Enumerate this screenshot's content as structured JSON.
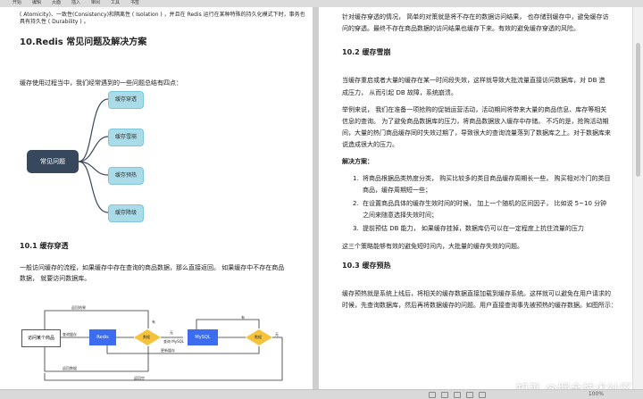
{
  "toolbar": {
    "items": [
      "开始",
      "编辑",
      "页面",
      "插入",
      "审阅",
      "工具",
      "书签"
    ]
  },
  "left": {
    "top_line1": "( Atomicity)、一致性(Consistency)和隔离性 ( Isolation ) ，并且在 Redis 运行在某种特殊的持久化模式下时，事务也",
    "top_line2": "具有持久性 ( Durability ) 。",
    "heading": "10.Redis 常见问题及解决方案",
    "intro": "缓存使用过程当中，我们经常遇到的一些问题总结有四点：",
    "mind": {
      "root": "常见问题",
      "nodes": [
        "缓存穿透",
        "缓存雪崩",
        "缓存预热",
        "缓存降级"
      ]
    },
    "sub_heading": "10.1 缓存穿透",
    "para1": "一般访问缓存的流程，如果缓存中存在查询的商品数据，那么直接返回。 如果缓存中不存在商品",
    "para2": "数据， 就要访问数据库。",
    "flow": {
      "user": "访问某个商品",
      "redis": "Redis",
      "mysql": "MySQL",
      "judge": "数据",
      "judge2": "数据",
      "query_cache": "查询缓存",
      "return_result": "返回结果",
      "none": "无",
      "query_mysql": "查询 MySQL",
      "have": "有",
      "have2": "有",
      "no2": "无",
      "return_data": "返回数据",
      "update_cache": "更新缓存",
      "return_empty": "返回空"
    }
  },
  "right": {
    "p0_l1": "针对缓存穿透的情况， 简单的对策就是将不存在的数据访问结果， 也存储到缓存中，避免缓存访",
    "p0_l2": "问的穿透。最终不存在商品数据的访问结果也缓存下来。有效的避免缓存穿透的风险。",
    "h_avalanche": "10.2 缓存雪崩",
    "p1_l1": "当缓存重启或者大量的缓存在某一时间段失效，这样就导致大批流量直接访问数据库，对 DB 造",
    "p1_l2": "成压力， 从而引起 DB 故障，系统崩溃。",
    "p2_l1": "举例来说， 我们在准备一项抢购的促销运营活动，活动期间将带来大量的商品信息、库存等相关",
    "p2_l2": "信息的查询。 为了避免商品数据库的压力，将商品数据放入缓存中存储。 不巧的是，抢购活动期",
    "p2_l3": "间，大量的热门商品缓存同时失效过期了，导致很大的查询流量落到了数据库之上。对于数据库来",
    "p2_l4": "说造成很大的压力。",
    "solution": "解决方案：",
    "li1_l1": "将商品根据品类热度分类， 购买比较多的类目商品缓存周期长一些， 购买相对冷门的类目",
    "li1_l2": "商品，缓存周期短一些；",
    "li2_l1": "在设置商品具体的缓存生效时间的时候， 加上一个随机的区间因子， 比如说 5~10 分钟",
    "li2_l2": "之间来随意选择失效时间；",
    "li3": "提前预估 DB 能力， 如果缓存挂掉，数据库仍可以在一定程度上抗住流量的压力",
    "p3": "这三个策略能够有效的避免短时间内，大批量的缓存失效的问题。",
    "h_warmup": "10.3 缓存预热",
    "p4_l1": "缓存预热就是系统上线后，将相关的缓存数据直接加载到缓存系统。这样就可以避免在用户请求的",
    "p4_l2": "时候，先查询数据库，然后再将数据缓存的问题。用户直接查询事先被预热的缓存数据。如图所示："
  },
  "watermark": "知乎 @掘金技术社区",
  "status": {
    "zoom": "100%"
  }
}
